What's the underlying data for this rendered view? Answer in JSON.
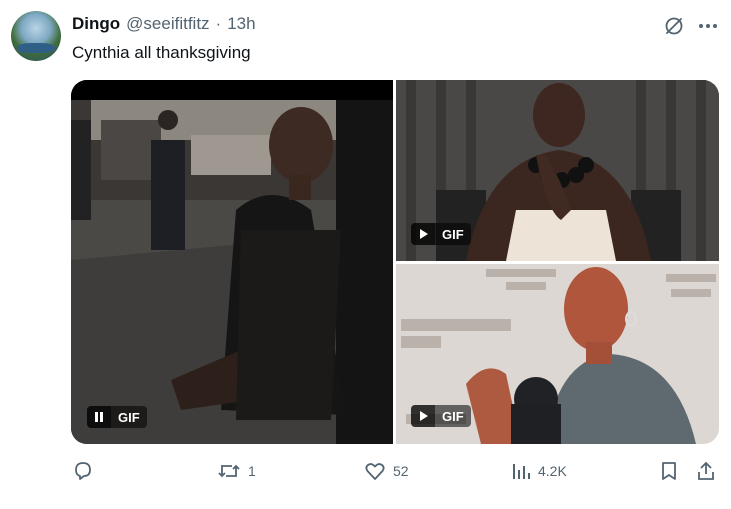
{
  "author": {
    "display_name": "Dingo",
    "handle": "@seeifitfitz",
    "separator": "·",
    "time": "13h"
  },
  "tweet": {
    "text": "Cynthia all thanksgiving"
  },
  "media": {
    "items": [
      {
        "badge_label": "GIF",
        "state": "playing",
        "control_icon": "pause-icon"
      },
      {
        "badge_label": "GIF",
        "state": "paused",
        "control_icon": "play-icon"
      },
      {
        "badge_label": "GIF",
        "state": "paused",
        "control_icon": "play-icon"
      }
    ]
  },
  "actions": {
    "reply": {
      "icon": "reply-icon",
      "count": ""
    },
    "retweet": {
      "icon": "retweet-icon",
      "count": "1"
    },
    "like": {
      "icon": "heart-icon",
      "count": "52"
    },
    "views": {
      "icon": "views-icon",
      "count": "4.2K"
    },
    "bookmark": {
      "icon": "bookmark-icon"
    },
    "share": {
      "icon": "share-icon"
    }
  },
  "colors": {
    "text_primary": "#0f1419",
    "text_secondary": "#536471",
    "background": "#ffffff"
  }
}
